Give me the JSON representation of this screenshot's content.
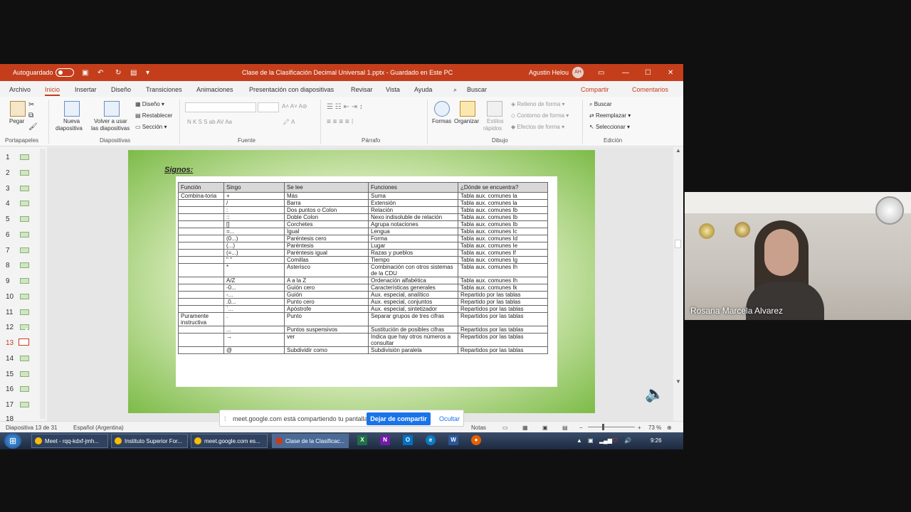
{
  "title_bar": {
    "autosave": "Autoguardado",
    "doc_title": "Clase de la Clasificación Decimal Universal 1.pptx  -  Guardado en Este PC",
    "user": "Agustin Helou",
    "initials": "AH"
  },
  "menu": {
    "tabs": [
      "Archivo",
      "Inicio",
      "Insertar",
      "Diseño",
      "Transiciones",
      "Animaciones",
      "Presentación con diapositivas",
      "Revisar",
      "Vista",
      "Ayuda"
    ],
    "search": "Buscar",
    "share": "Compartir",
    "comments": "Comentarios"
  },
  "ribbon": {
    "paste": "Pegar",
    "new_slide_1": "Nueva",
    "new_slide_2": "diapositiva",
    "reuse_1": "Volver a usar",
    "reuse_2": "las diapositivas",
    "layout": "Diseño",
    "reset": "Restablecer",
    "section": "Sección",
    "shapes": "Formas",
    "arrange": "Organizar",
    "styles_1": "Estilos",
    "styles_2": "rápidos",
    "fill": "Relleno de forma",
    "outline": "Contorno de forma",
    "effects": "Efectos de forma",
    "find": "Buscar",
    "replace": "Reemplazar",
    "select": "Seleccionar",
    "groups": [
      "Portapapeles",
      "Diapositivas",
      "Fuente",
      "Párrafo",
      "Dibujo",
      "Edición"
    ]
  },
  "thumbnails": [
    "1",
    "2",
    "3",
    "4",
    "5",
    "6",
    "7",
    "8",
    "9",
    "10",
    "11",
    "12",
    "13",
    "14",
    "15",
    "16",
    "17",
    "18"
  ],
  "selected_slide": "13",
  "slide": {
    "title": "Signos:",
    "headers": [
      "Función",
      "Singo",
      "Se lee",
      "Funciones",
      "¿Dónde se encuentra?"
    ],
    "rows": [
      [
        "Combina-toria",
        "+",
        "Más",
        "Suma",
        "Tabla aux. comunes la"
      ],
      [
        "",
        "/",
        "Barra",
        "Extensión",
        "Tabla aux. comunes la"
      ],
      [
        "",
        ":",
        "Dos puntos o Colon",
        "Relación",
        "Tabla aux. comunes Ib"
      ],
      [
        "",
        "::",
        "Doble Colon",
        "Nexo indisoluble de relación",
        "Tabla aux. comunes Ib"
      ],
      [
        "",
        "[]",
        "Corchetes",
        "Agrupa notaciones",
        "Tabla aux. comunes Ib"
      ],
      [
        "",
        "=...",
        "Igual",
        "Lengua",
        "Tabla aux. comunes Ic"
      ],
      [
        "",
        "(0...)",
        "Paréntesis cero",
        "Forma",
        "Tabla aux. comunes Id"
      ],
      [
        "",
        "(...)",
        "Paréntesis",
        "Lugar",
        "Tabla aux. comunes Ie"
      ],
      [
        "",
        "(=...)",
        "Paréntesis igual",
        "Razas y pueblos",
        "Tabla aux. comunes If"
      ],
      [
        "",
        "\" \"",
        "Comillas",
        "Tiempo",
        "Tabla aux. comunes Ig"
      ],
      [
        "",
        "*",
        "Asterisco",
        "Combinación con otros sistemas de la CDU",
        "Tabla aux. comunes Ih"
      ],
      [
        "",
        "A/Z",
        "A a la Z",
        "Ordenación alfabética",
        "Tabla aux. comunes Ih"
      ],
      [
        "",
        "-0...",
        "Guión cero",
        "Características generales",
        "Tabla aux. comunes Ik"
      ],
      [
        "",
        "-...",
        "Guión",
        "Aux. especial, analítico",
        "Repartido por las tablas"
      ],
      [
        "",
        ".0...",
        "Punto cero",
        "Aux. especial, conjuntos",
        "Repartido por las tablas"
      ],
      [
        "",
        "`...",
        "Apóstrofe",
        "Aux. especial, sintetizador",
        "Repartidos por las tablas"
      ],
      [
        "Puramente instructiva",
        ".",
        "Punto",
        "Separar grupos de tres cifras",
        "Repartidos por las tablas"
      ],
      [
        "",
        "...",
        "Puntos suspensivos",
        "Sustitución de posibles cifras",
        "Repartidos por las tablas"
      ],
      [
        "",
        "→",
        "ver",
        "Indica que hay otros números a consultar",
        "Repartidos por las tablas"
      ],
      [
        "",
        "@",
        "Subdividir como",
        "Subdivisión paralela",
        "Repartidos por las tablas"
      ]
    ]
  },
  "status": {
    "slide_info": "Diapositiva 13 de 31",
    "language": "Español (Argentina)",
    "notes": "Notas",
    "zoom": "73 %"
  },
  "share_bar": {
    "message": "meet.google.com está compartiendo tu pantalla.",
    "stop": "Dejar de compartir",
    "hide": "Ocultar"
  },
  "taskbar": {
    "items": [
      "Meet - rqq-kdxf-jmh...",
      "Instituto Superior For...",
      "meet.google.com es...",
      "Clase de la Clasificac..."
    ],
    "time": "9:26"
  },
  "video": {
    "name": "Rosana Marcela Alvarez"
  }
}
